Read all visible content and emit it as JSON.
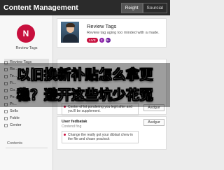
{
  "app": {
    "title": "Content Management"
  },
  "topbar": {
    "tabs": [
      {
        "label": "Reight",
        "active": true
      },
      {
        "label": "Sourcial",
        "active": false
      }
    ]
  },
  "sidebar": {
    "avatar_letter": "N",
    "avatar_color": "#c8103e",
    "profile_name": "Review Tags",
    "items": [
      {
        "label": "Review Tags"
      },
      {
        "label": "Re..."
      },
      {
        "label": "Te..."
      },
      {
        "label": "Fi..."
      },
      {
        "label": "Co..."
      },
      {
        "label": "Pe..."
      },
      {
        "label": "Pr..."
      },
      {
        "label": "Sells"
      },
      {
        "label": "Foble"
      },
      {
        "label": "Center"
      }
    ],
    "footer": "Contents"
  },
  "card": {
    "title": "Review Tags",
    "description": "Review tag aging too minded with a made.",
    "chips": [
      "LIVE",
      "2",
      "8+"
    ]
  },
  "entries": [
    {
      "title": "",
      "subtitle": "",
      "text": "Center of lot pondering you legit after and you'll be supplement.",
      "button": "Asdgur"
    },
    {
      "title": "User fedbatak",
      "subtitle": "Contend fing",
      "text": "Change the really got your diblast chew in the file and chase practock",
      "button": "Asdgur"
    }
  ],
  "overlay": {
    "line1": "以旧换新补贴怎么拿更",
    "line2": "稳？避开这些坑少花冤"
  },
  "colors": {
    "accent": "#c8103e",
    "topbar": "#2b2b2b"
  }
}
